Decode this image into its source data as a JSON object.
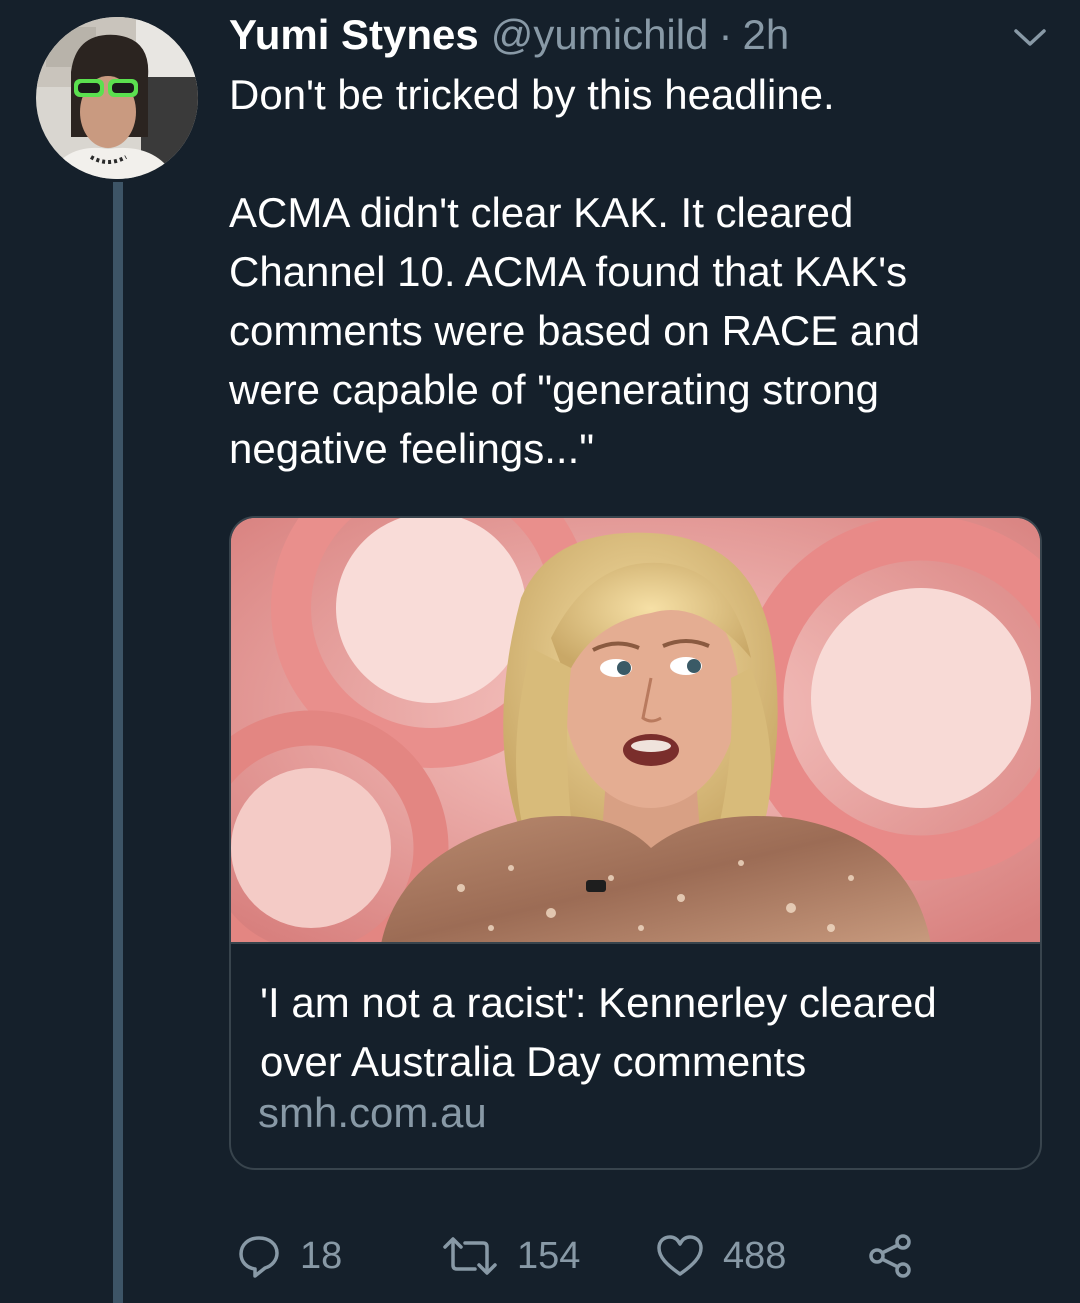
{
  "tweet": {
    "author_name": "Yumi Stynes",
    "handle": "@yumichild",
    "separator": "·",
    "time": "2h",
    "text": "Don't be tricked by this headline.\n\nACMA didn't clear KAK. It cleared\nChannel 10. ACMA found that KAK's\ncomments were based on RACE and\nwere capable of \"generating strong\nnegative feelings...\""
  },
  "card": {
    "title": "'I am not a racist': Kennerley cleared over Australia Day comments",
    "domain": "smh.com.au"
  },
  "actions": {
    "replies": "18",
    "retweets": "154",
    "likes": "488"
  },
  "icons": {
    "more": "chevron-down-icon",
    "reply": "reply-bubble-icon",
    "retweet": "retweet-arrows-icon",
    "like": "heart-icon",
    "share": "share-nodes-icon"
  },
  "colors": {
    "background": "#15202b",
    "secondary_text": "#8899a6",
    "border": "#38444d",
    "thread_line": "#3d5466"
  }
}
